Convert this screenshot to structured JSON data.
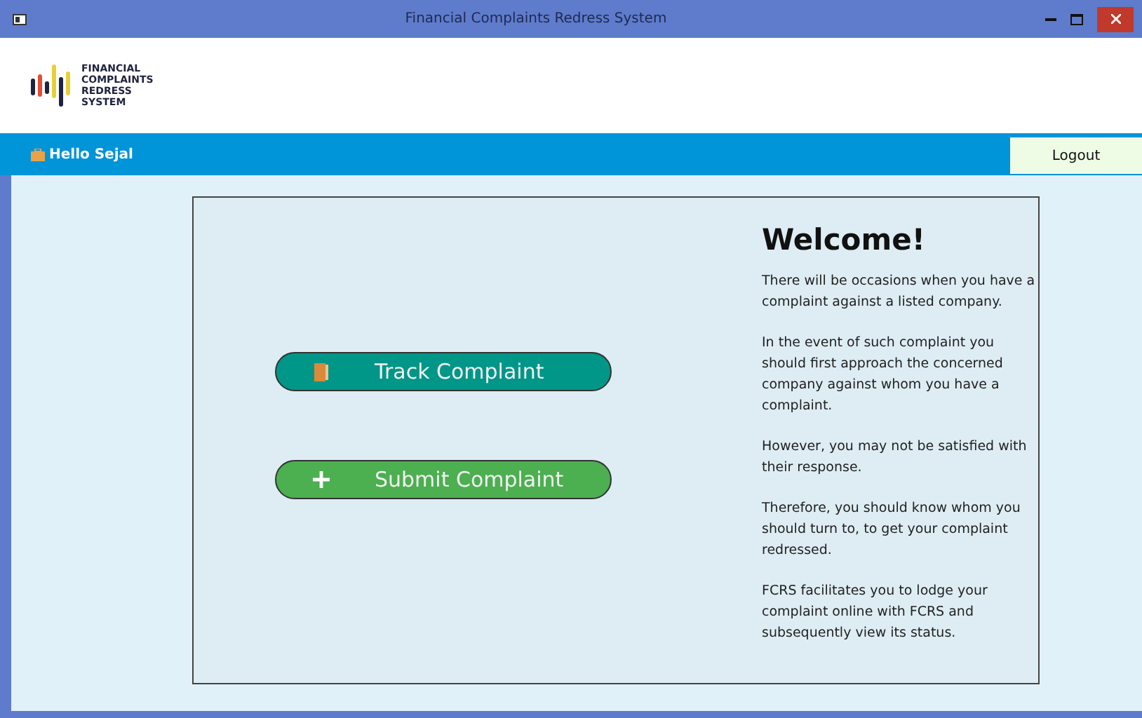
{
  "window": {
    "title": "Financial Complaints Redress System"
  },
  "logo": {
    "lines": [
      "FINANCIAL",
      "COMPLAINTS",
      "REDRESS",
      "SYSTEM"
    ]
  },
  "nav": {
    "greeting": "Hello Sejal",
    "logout": "Logout"
  },
  "actions": [
    {
      "kind": "track",
      "label": "Track Complaint"
    },
    {
      "kind": "submit",
      "label": "Submit Complaint"
    }
  ],
  "welcome": {
    "heading": "Welcome!",
    "paragraphs": [
      "There will be occasions when you have a complaint against a listed company.",
      "In the event of such complaint you should first approach the concerned company against whom you have a complaint.",
      "However, you may not be satisfied with their response.",
      "Therefore, you should know whom you should turn to, to get your complaint redressed.",
      "FCRS facilitates you to lodge your complaint online with FCRS and subsequently view its status."
    ]
  }
}
